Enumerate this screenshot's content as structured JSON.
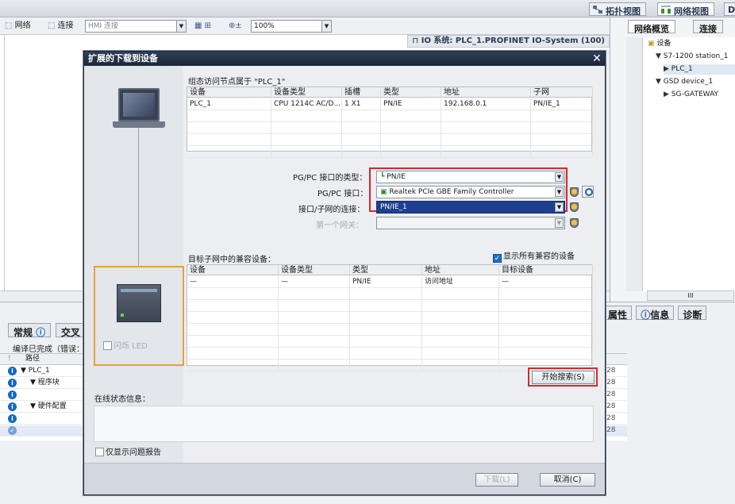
{
  "topbar": {
    "topology_view": "拓扑视图",
    "network_view": "网络视图",
    "device_view_partial": "D"
  },
  "toolbar": {
    "network": "网络",
    "connections": "连接",
    "hmi_connection": "HMI 连接",
    "zoom": "100%"
  },
  "canvas": {
    "io_system": "IO 系统: PLC_1.PROFINET IO-System (100)"
  },
  "right_pane": {
    "tab_overview": "网络概览",
    "tab_connections": "连接",
    "tree": [
      {
        "label": "设备",
        "indent": 0,
        "prefix": ""
      },
      {
        "label": "S7-1200 station_1",
        "indent": 1,
        "prefix": "▼"
      },
      {
        "label": "PLC_1",
        "indent": 2,
        "prefix": "▶"
      },
      {
        "label": "GSD device_1",
        "indent": 1,
        "prefix": "▼"
      },
      {
        "label": "SG-GATEWAY",
        "indent": 2,
        "prefix": "▶"
      }
    ],
    "scroll_mid": "III"
  },
  "bottom": {
    "tab_general": "常规",
    "tab_cross": "交叉",
    "status_text": "编译已完成（错误：",
    "col_path": "路径",
    "rows": [
      {
        "icon": "i",
        "text": "▼  PLC_1",
        "indent": 26,
        "num": "28"
      },
      {
        "icon": "i",
        "text": "▼  程序块",
        "indent": 38,
        "num": "28"
      },
      {
        "icon": "i",
        "text": "",
        "indent": 38,
        "num": "28"
      },
      {
        "icon": "i",
        "text": "▼  硬件配置",
        "indent": 38,
        "num": "28"
      },
      {
        "icon": "i",
        "text": "",
        "indent": 38,
        "num": "28"
      },
      {
        "icon": "✓",
        "text": "",
        "indent": 38,
        "num": "28"
      }
    ],
    "rtab_properties": "属性",
    "rtab_info": "信息",
    "rtab_diag": "诊断"
  },
  "dialog": {
    "title": "扩展的下载到设备",
    "close": "✕",
    "configured_caption": "组态访问节点属于 \"PLC_1\"",
    "top_grid": {
      "headers": [
        "设备",
        "设备类型",
        "插槽",
        "类型",
        "地址",
        "子网"
      ],
      "rows": [
        [
          "PLC_1",
          "CPU 1214C AC/D...",
          "1 X1",
          "PN/IE",
          "192.168.0.1",
          "PN/IE_1"
        ]
      ]
    },
    "pgpc_type_label": "PG/PC 接口的类型：",
    "pgpc_type_value": "PN/IE",
    "pgpc_iface_label": "PG/PC 接口：",
    "pgpc_iface_value": "Realtek PCIe GBE Family Controller",
    "subnet_conn_label": "接口/子网的连接：",
    "subnet_conn_value": "PN/IE_1",
    "gateway_label": "第一个网关：",
    "gateway_value": "",
    "compatible_caption": "目标子网中的兼容设备：",
    "show_all_label": "显示所有兼容的设备",
    "bottom_grid": {
      "headers": [
        "设备",
        "设备类型",
        "类型",
        "地址",
        "目标设备"
      ],
      "rows": [
        [
          "—",
          "—",
          "PN/IE",
          "访问地址",
          "—"
        ]
      ]
    },
    "flash_led": "闪烁 LED",
    "start_search": "开始搜索(S)",
    "online_status_label": "在线状态信息：",
    "only_problems": "仅显示问题报告",
    "load_button": "下载(L)",
    "cancel_button": "取消(C)"
  }
}
